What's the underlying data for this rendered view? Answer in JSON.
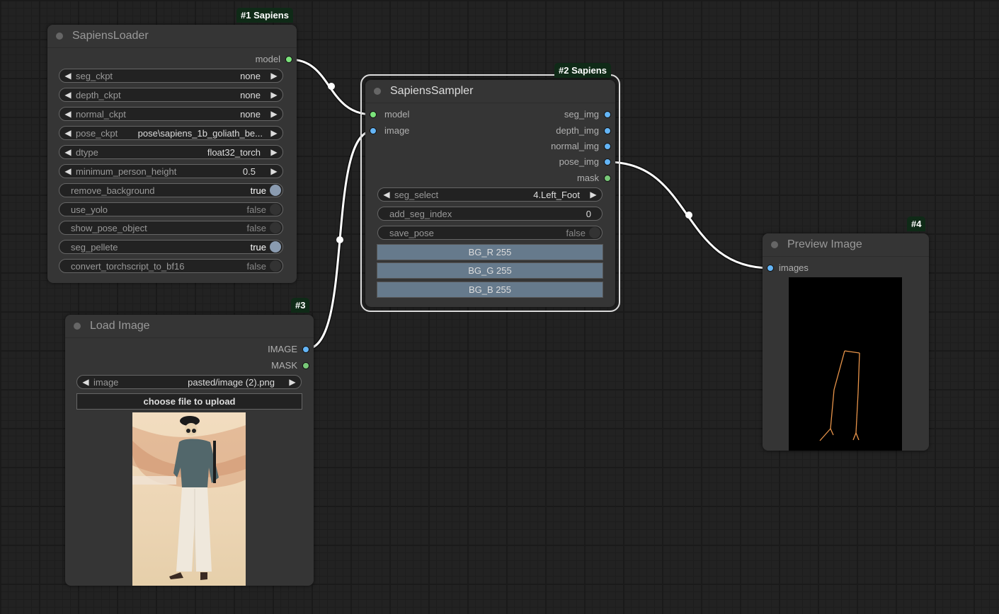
{
  "colors": {
    "canvas_bg": "#222222",
    "node_bg": "#353535",
    "badge_bg": "#0f2a17",
    "model_slot": "#7be37b",
    "image_slot": "#64b5f6",
    "mask_slot": "#78c878",
    "link": "#ffffff",
    "pose_skeleton": "#e8944a"
  },
  "nodes": {
    "sapiens_loader": {
      "badge": "#1 Sapiens",
      "title": "SapiensLoader",
      "outputs": [
        {
          "label": "model",
          "type": "MODEL"
        }
      ],
      "combo_widgets": [
        {
          "label": "seg_ckpt",
          "value": "none"
        },
        {
          "label": "depth_ckpt",
          "value": "none"
        },
        {
          "label": "normal_ckpt",
          "value": "none"
        },
        {
          "label": "pose_ckpt",
          "value": "pose\\sapiens_1b_goliath_be..."
        },
        {
          "label": "dtype",
          "value": "float32_torch"
        },
        {
          "label": "minimum_person_height",
          "value": "0.5"
        }
      ],
      "toggle_widgets": [
        {
          "label": "remove_background",
          "value": "true",
          "on": true
        },
        {
          "label": "use_yolo",
          "value": "false",
          "on": false
        },
        {
          "label": "show_pose_object",
          "value": "false",
          "on": false
        },
        {
          "label": "seg_pellete",
          "value": "true",
          "on": true
        },
        {
          "label": "convert_torchscript_to_bf16",
          "value": "false",
          "on": false
        }
      ]
    },
    "sapiens_sampler": {
      "badge": "#2 Sapiens",
      "title": "SapiensSampler",
      "inputs": [
        {
          "label": "model",
          "type": "MODEL"
        },
        {
          "label": "image",
          "type": "IMAGE"
        }
      ],
      "outputs": [
        {
          "label": "seg_img",
          "type": "IMAGE"
        },
        {
          "label": "depth_img",
          "type": "IMAGE"
        },
        {
          "label": "normal_img",
          "type": "IMAGE"
        },
        {
          "label": "pose_img",
          "type": "IMAGE"
        },
        {
          "label": "mask",
          "type": "MASK"
        }
      ],
      "seg_select": {
        "label": "seg_select",
        "value": "4.Left_Foot"
      },
      "add_seg_index": {
        "label": "add_seg_index",
        "value": "0"
      },
      "save_pose": {
        "label": "save_pose",
        "value": "false",
        "on": false
      },
      "bg_buttons": [
        {
          "label": "BG_R",
          "value": "255"
        },
        {
          "label": "BG_G",
          "value": "255"
        },
        {
          "label": "BG_B",
          "value": "255"
        }
      ]
    },
    "load_image": {
      "badge": "#3",
      "title": "Load Image",
      "outputs": [
        {
          "label": "IMAGE",
          "type": "IMAGE"
        },
        {
          "label": "MASK",
          "type": "MASK"
        }
      ],
      "image_combo": {
        "label": "image",
        "value": "pasted/image (2).png"
      },
      "upload_label": "choose file to upload"
    },
    "preview_image": {
      "badge": "#4",
      "title": "Preview Image",
      "inputs": [
        {
          "label": "images",
          "type": "IMAGE"
        }
      ]
    }
  }
}
